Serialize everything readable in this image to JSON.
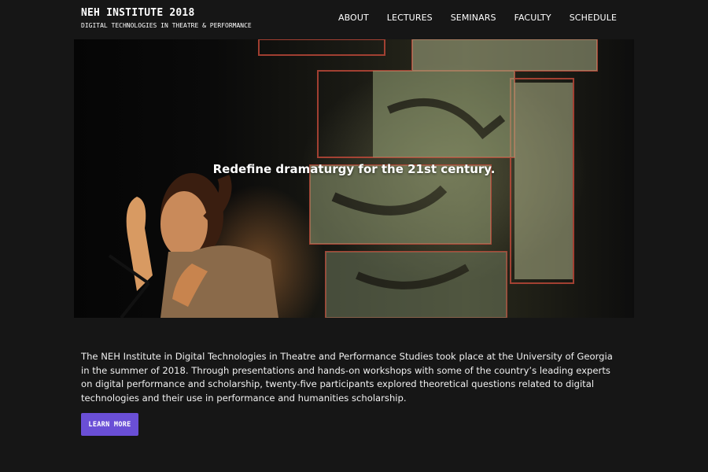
{
  "header": {
    "title": "NEH INSTITUTE 2018",
    "subtitle": "DIGITAL TECHNOLOGIES IN THEATRE & PERFORMANCE"
  },
  "nav": {
    "items": [
      {
        "label": "ABOUT"
      },
      {
        "label": "LECTURES"
      },
      {
        "label": "SEMINARS"
      },
      {
        "label": "FACULTY"
      },
      {
        "label": "SCHEDULE"
      }
    ]
  },
  "hero": {
    "tagline": "Redefine dramaturgy for the 21st century."
  },
  "intro": {
    "paragraph": "The NEH Institute in Digital Technologies in Theatre and Performance Studies took place at the University of Georgia in the summer of 2018. Through presentations and hands-on workshops with some of the country’s leading experts on digital performance and scholarship, twenty-five participants explored theoretical questions related to digital technologies and their use in performance and humanities scholarship.",
    "button_label": "LEARN MORE"
  },
  "colors": {
    "background": "#161616",
    "button": "#6a4fd6",
    "text": "#ffffff"
  }
}
